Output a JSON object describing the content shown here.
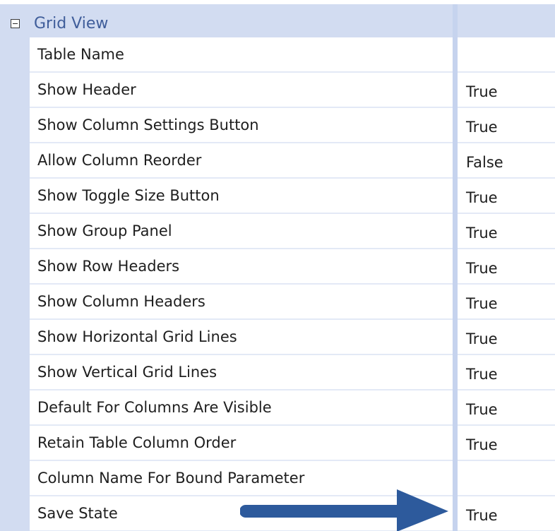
{
  "group": {
    "title": "Grid View",
    "toggle_icon": "collapse-minus-icon"
  },
  "properties": [
    {
      "name": "Table Name",
      "value": ""
    },
    {
      "name": "Show Header",
      "value": "True"
    },
    {
      "name": "Show Column Settings Button",
      "value": "True"
    },
    {
      "name": "Allow Column Reorder",
      "value": "False"
    },
    {
      "name": "Show Toggle Size Button",
      "value": "True"
    },
    {
      "name": "Show Group Panel",
      "value": "True"
    },
    {
      "name": "Show Row Headers",
      "value": "True"
    },
    {
      "name": "Show Column Headers",
      "value": "True"
    },
    {
      "name": "Show Horizontal Grid Lines",
      "value": "True"
    },
    {
      "name": "Show Vertical Grid Lines",
      "value": "True"
    },
    {
      "name": "Default For Columns Are Visible",
      "value": "True"
    },
    {
      "name": "Retain Table Column Order",
      "value": "True"
    },
    {
      "name": "Column Name For Bound Parameter",
      "value": ""
    },
    {
      "name": "Save State",
      "value": "True"
    }
  ],
  "annotation": {
    "icon": "arrow-right-icon",
    "color": "#2d5a9c"
  },
  "colors": {
    "gutter": "#d2dcf1",
    "splitter": "#c6d3ee",
    "row_divider": "#e3e9f6",
    "group_title": "#3f5d9a"
  }
}
